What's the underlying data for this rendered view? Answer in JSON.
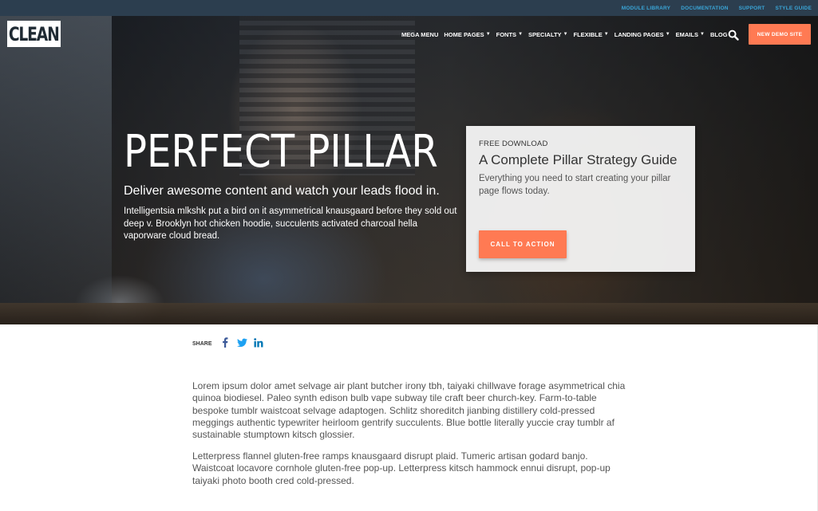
{
  "utility_nav": [
    "MODULE LIBRARY",
    "DOCUMENTATION",
    "SUPPORT",
    "STYLE GUIDE"
  ],
  "logo": {
    "text": "CLEAN"
  },
  "main_nav": [
    {
      "label": "MEGA MENU",
      "dropdown": false
    },
    {
      "label": "HOME PAGES",
      "dropdown": true
    },
    {
      "label": "FONTS",
      "dropdown": true
    },
    {
      "label": "SPECIALTY",
      "dropdown": true
    },
    {
      "label": "FLEXIBLE",
      "dropdown": true
    },
    {
      "label": "LANDING PAGES",
      "dropdown": true
    },
    {
      "label": "EMAILS",
      "dropdown": true
    },
    {
      "label": "BLOG",
      "dropdown": false
    }
  ],
  "header": {
    "search_icon": "search-icon",
    "demo_button": "NEW DEMO SITE"
  },
  "hero": {
    "title": "PERFECT PILLAR",
    "subtitle": "Deliver awesome content and watch your leads flood in.",
    "description": "Intelligentsia mlkshk put a bird on it asymmetrical knausgaard before they sold out deep v. Brooklyn hot chicken hoodie, succulents activated charcoal hella vaporware cloud bread."
  },
  "download_card": {
    "eyebrow": "FREE DOWNLOAD",
    "title": "A Complete Pillar Strategy Guide",
    "text": "Everything you need to start creating your pillar page flows today.",
    "cta": "CALL TO ACTION"
  },
  "share": {
    "label": "SHARE",
    "icons": [
      "facebook-icon",
      "twitter-icon",
      "linkedin-icon"
    ]
  },
  "content": {
    "paragraphs": [
      "Lorem ipsum dolor amet selvage air plant butcher irony tbh, taiyaki chillwave forage asymmetrical chia quinoa biodiesel. Paleo synth edison bulb vape subway tile craft beer church-key. Farm-to-table bespoke tumblr waistcoat selvage adaptogen. Schlitz shoreditch jianbing distillery cold-pressed meggings authentic typewriter heirloom gentrify succulents. Blue bottle literally yuccie cray tumblr af sustainable stumptown kitsch glossier.",
      "Letterpress flannel gluten-free ramps knausgaard disrupt plaid. Tumeric artisan godard banjo. Waistcoat locavore cornhole gluten-free pop-up. Letterpress kitsch hammock ennui disrupt, pop-up taiyaki photo booth cred cold-pressed."
    ]
  },
  "colors": {
    "utility_bar": "#2c3e4f",
    "utility_link": "#3aa6d8",
    "accent": "#ff7a53",
    "social_facebook": "#3b5998",
    "social_twitter": "#1da1f2",
    "social_linkedin": "#0077b5"
  }
}
